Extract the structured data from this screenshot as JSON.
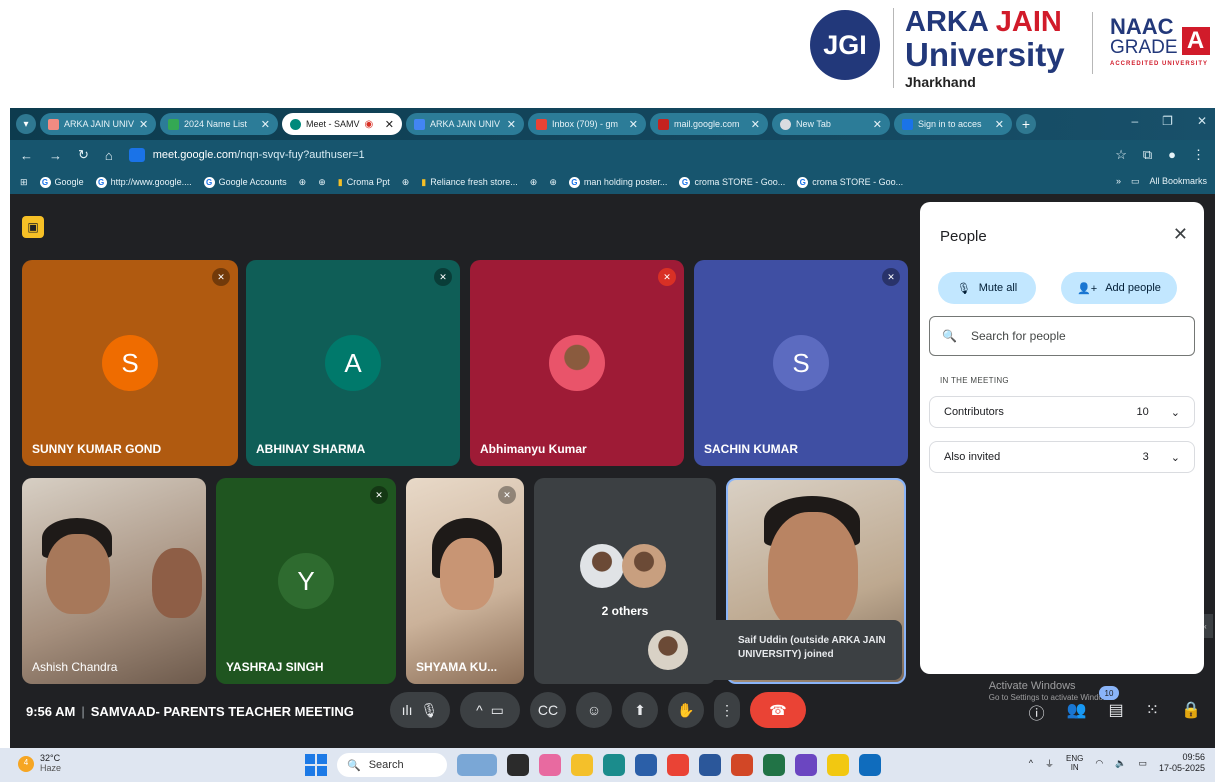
{
  "branding": {
    "jgi": "JGI",
    "uni_line1_a": "ARKA ",
    "uni_line1_b": "JAIN",
    "uni_line2": "University",
    "uni_line3": "Jharkhand",
    "naac_line1": "NAAC",
    "naac_line2": "GRADE",
    "naac_grade": "A",
    "naac_line3": "ACCREDITED UNIVERSITY"
  },
  "browser": {
    "tabs": [
      {
        "label": "ARKA JAIN UNIV",
        "color": "#f28b82"
      },
      {
        "label": "2024 Name List",
        "color": "#34a853"
      },
      {
        "label": "Meet - SAMV",
        "color": "#00897b",
        "active": true
      },
      {
        "label": "ARKA JAIN UNIV",
        "color": "#4285f4"
      },
      {
        "label": "Inbox (709) - gm",
        "color": "#ea4335"
      },
      {
        "label": "mail.google.com",
        "color": "#c5221f"
      },
      {
        "label": "New Tab",
        "color": "#dadce0"
      },
      {
        "label": "Sign in to acces",
        "color": "#1a73e8"
      }
    ],
    "url_host": "meet.google.com",
    "url_path": "/nqn-svqv-fuy?authuser=1",
    "bookmarks": [
      "Google",
      "http://www.google....",
      "Google Accounts",
      "Croma Ppt",
      "Reliance fresh store...",
      "man holding poster...",
      "croma STORE - Goo...",
      "croma STORE - Goo..."
    ],
    "all_bookmarks": "All Bookmarks"
  },
  "tiles": [
    {
      "name": "SUNNY KUMAR GOND",
      "initial": "S",
      "bg": "#b05a10",
      "avatar": "#ef6c00"
    },
    {
      "name": "ABHINAY SHARMA",
      "initial": "A",
      "bg": "#0f5e57",
      "avatar": "#00796b"
    },
    {
      "name": "Abhimanyu Kumar",
      "initial": "",
      "bg": "#9e1b36",
      "avatar": ""
    },
    {
      "name": "SACHIN KUMAR",
      "initial": "S",
      "bg": "#3f4fa3",
      "avatar": "#5c6bc0"
    },
    {
      "name": "Ashish Chandra"
    },
    {
      "name": "YASHRAJ SINGH",
      "initial": "Y",
      "bg": "#1f5520",
      "avatar": "#2e6b2f"
    },
    {
      "name": "SHYAMA KU..."
    },
    {
      "name": "2 others"
    },
    {
      "name": ""
    }
  ],
  "toast": {
    "text": "Saif Uddin (outside ARKA JAIN UNIVERSITY) joined"
  },
  "people_panel": {
    "title": "People",
    "mute_all": "Mute all",
    "add_people": "Add people",
    "search_placeholder": "Search for people",
    "section": "IN THE MEETING",
    "groups": [
      {
        "label": "Contributors",
        "count": "10"
      },
      {
        "label": "Also invited",
        "count": "3"
      }
    ]
  },
  "bottom_bar": {
    "time": "9:56 AM",
    "meeting_name": "SAMVAAD- PARENTS TEACHER MEETING",
    "participants_badge": "10",
    "watermark_1": "Activate Windows",
    "watermark_2": "Go to Settings to activate Windows."
  },
  "taskbar": {
    "temp": "32°C",
    "weather": "Haze",
    "weather_badge": "4",
    "search": "Search",
    "lang_1": "ENG",
    "lang_2": "IN",
    "clock_time": "09:56",
    "clock_date": "17-05-2025"
  }
}
